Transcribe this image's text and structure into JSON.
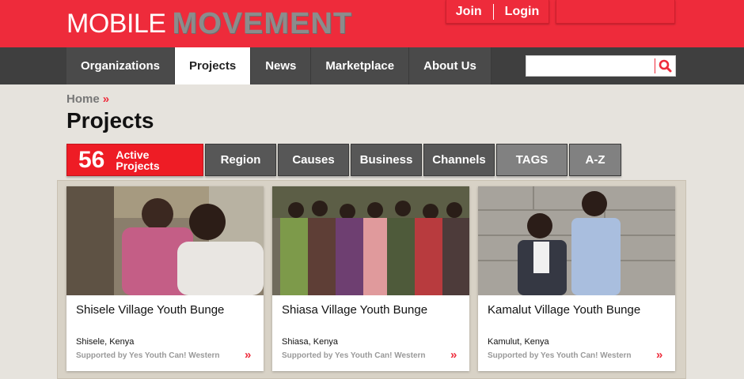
{
  "brand": {
    "logo_light": "MOBILE",
    "logo_bold": "MOVEMENT",
    "accent_color": "#ee2b3b"
  },
  "auth": {
    "join_label": "Join",
    "login_label": "Login"
  },
  "nav": {
    "items": [
      {
        "label": "Organizations",
        "active": false
      },
      {
        "label": "Projects",
        "active": true
      },
      {
        "label": "News",
        "active": false
      },
      {
        "label": "Marketplace",
        "active": false
      },
      {
        "label": "About Us",
        "active": false
      }
    ]
  },
  "search": {
    "placeholder": "",
    "icon": "search-icon"
  },
  "breadcrumb": {
    "home": "Home",
    "arrow": "»"
  },
  "page_title": "Projects",
  "filters": {
    "count": "56",
    "count_label_1": "Active",
    "count_label_2": "Projects",
    "buttons": [
      {
        "label": "Region"
      },
      {
        "label": "Causes"
      },
      {
        "label": "Business"
      },
      {
        "label": "Channels"
      },
      {
        "label": "TAGS"
      },
      {
        "label": "A-Z"
      }
    ]
  },
  "projects": [
    {
      "title": "Shisele Village Youth Bunge",
      "location": "Shisele, Kenya",
      "supported_by": "Supported by Yes Youth Can! Western",
      "more": "»",
      "photo": "photo-two-people-seated"
    },
    {
      "title": "Shiasa Village Youth Bunge",
      "location": "Shiasa, Kenya",
      "supported_by": "Supported by Yes Youth Can! Western",
      "more": "»",
      "photo": "photo-large-group"
    },
    {
      "title": "Kamalut Village Youth Bunge",
      "location": "Kamulut, Kenya",
      "supported_by": "Supported by Yes Youth Can! Western",
      "more": "»",
      "photo": "photo-two-people-standing"
    }
  ]
}
